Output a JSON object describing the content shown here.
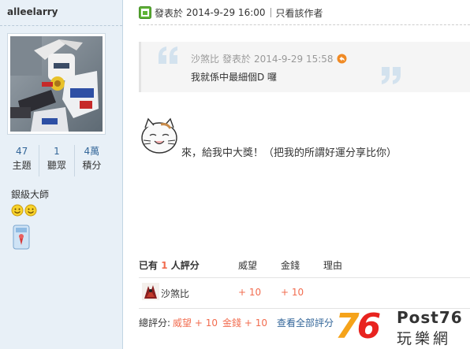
{
  "sidebar": {
    "username": "alleelarry",
    "stats": [
      {
        "value": "47",
        "label": "主題"
      },
      {
        "value": "1",
        "label": "聽眾"
      },
      {
        "value": "4萬",
        "label": "積分"
      }
    ],
    "rank": "銀級大師"
  },
  "post": {
    "posted_label": "發表於",
    "posted_date": "2014-9-29 16:00",
    "only_author": "只看該作者",
    "quote": {
      "author": "沙煞比",
      "posted_label": "發表於",
      "date": "2014-9-29 15:58",
      "text": "我就係中最細個D 囉"
    },
    "message": "來，給我中大獎！（把我的所謂好運分享比你）"
  },
  "rating": {
    "title_prefix": "已有",
    "count": "1",
    "title_suffix": "人評分",
    "col_prestige": "威望",
    "col_money": "金錢",
    "col_reason": "理由",
    "rows": [
      {
        "user": "沙煞比",
        "prestige": "+ 10",
        "money": "+ 10"
      }
    ],
    "total_label": "總評分:",
    "total_prestige": "威望 + 10",
    "total_money": "金錢 + 10",
    "view_all": "查看全部評分"
  },
  "watermark": {
    "num_7": "7",
    "num_6": "6",
    "brand_top": "Post76",
    "brand_bottom": "玩樂網"
  },
  "colors": {
    "sidebar_bg": "#e8f0f7",
    "link_blue": "#336699",
    "accent_orange": "#f26c4f"
  }
}
